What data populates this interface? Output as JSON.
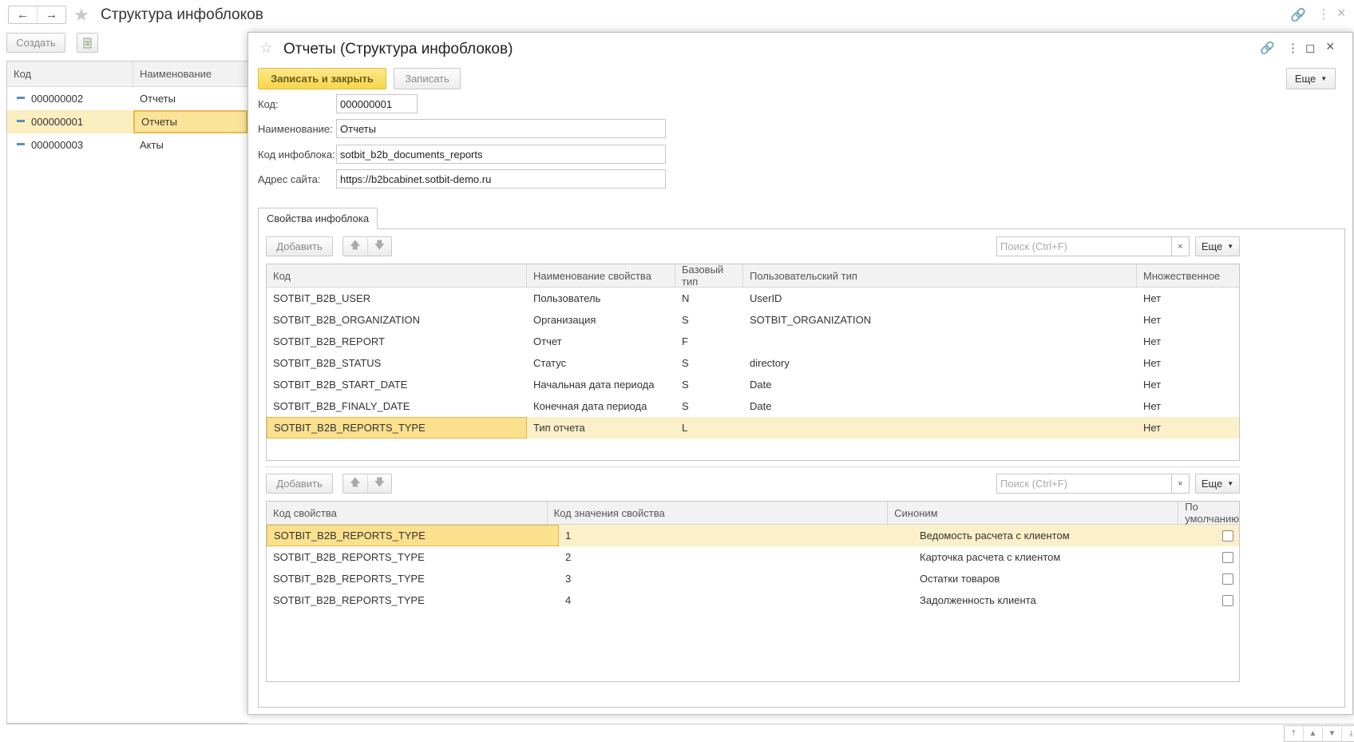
{
  "outer": {
    "title": "Структура инфоблоков",
    "nav_back": "←",
    "nav_forward": "→",
    "create_label": "Создать",
    "list": {
      "headers": [
        "Код",
        "Наименование"
      ],
      "rows": [
        {
          "code": "000000002",
          "name": "Отчеты"
        },
        {
          "code": "000000001",
          "name": "Отчеты"
        },
        {
          "code": "000000003",
          "name": "Акты"
        }
      ]
    },
    "scroll_nav": [
      "⤒",
      "▲",
      "▼",
      "⤓"
    ]
  },
  "dialog": {
    "title": "Отчеты (Структура инфоблоков)",
    "save_close_label": "Записать и закрыть",
    "save_label": "Записать",
    "more_label": "Еще",
    "fields": {
      "code_label": "Код:",
      "code_value": "000000001",
      "name_label": "Наименование:",
      "name_value": "Отчеты",
      "iblock_label": "Код инфоблока:",
      "iblock_value": "sotbit_b2b_documents_reports",
      "site_label": "Адрес сайта:",
      "site_value": "https://b2bcabinet.sotbit-demo.ru"
    },
    "tab_label": "Свойства инфоблока",
    "toolbar": {
      "add_label": "Добавить",
      "search_placeholder": "Поиск (Ctrl+F)",
      "more_label": "Еще",
      "clear": "×",
      "up": "🡅",
      "down": "🡇"
    },
    "properties": {
      "headers": [
        "Код",
        "Наименование свойства",
        "Базовый тип",
        "Пользовательский тип",
        "Множественное"
      ],
      "rows": [
        [
          "SOTBIT_B2B_USER",
          "Пользователь",
          "N",
          "UserID",
          "Нет"
        ],
        [
          "SOTBIT_B2B_ORGANIZATION",
          "Организация",
          "S",
          "SOTBIT_ORGANIZATION",
          "Нет"
        ],
        [
          "SOTBIT_B2B_REPORT",
          "Отчет",
          "F",
          "",
          "Нет"
        ],
        [
          "SOTBIT_B2B_STATUS",
          "Статус",
          "S",
          "directory",
          "Нет"
        ],
        [
          "SOTBIT_B2B_START_DATE",
          "Начальная дата периода",
          "S",
          "Date",
          "Нет"
        ],
        [
          "SOTBIT_B2B_FINALY_DATE",
          "Конечная дата периода",
          "S",
          "Date",
          "Нет"
        ],
        [
          "SOTBIT_B2B_REPORTS_TYPE",
          "Тип отчета",
          "L",
          "",
          "Нет"
        ]
      ]
    },
    "values": {
      "headers": [
        "Код свойства",
        "Код значения свойства",
        "Синоним",
        "По умолчанию"
      ],
      "rows": [
        [
          "SOTBIT_B2B_REPORTS_TYPE",
          "1",
          "Ведомость расчета с клиентом"
        ],
        [
          "SOTBIT_B2B_REPORTS_TYPE",
          "2",
          "Карточка расчета с клиентом"
        ],
        [
          "SOTBIT_B2B_REPORTS_TYPE",
          "3",
          "Остатки товаров"
        ],
        [
          "SOTBIT_B2B_REPORTS_TYPE",
          "4",
          "Задолженность клиента"
        ]
      ]
    }
  }
}
